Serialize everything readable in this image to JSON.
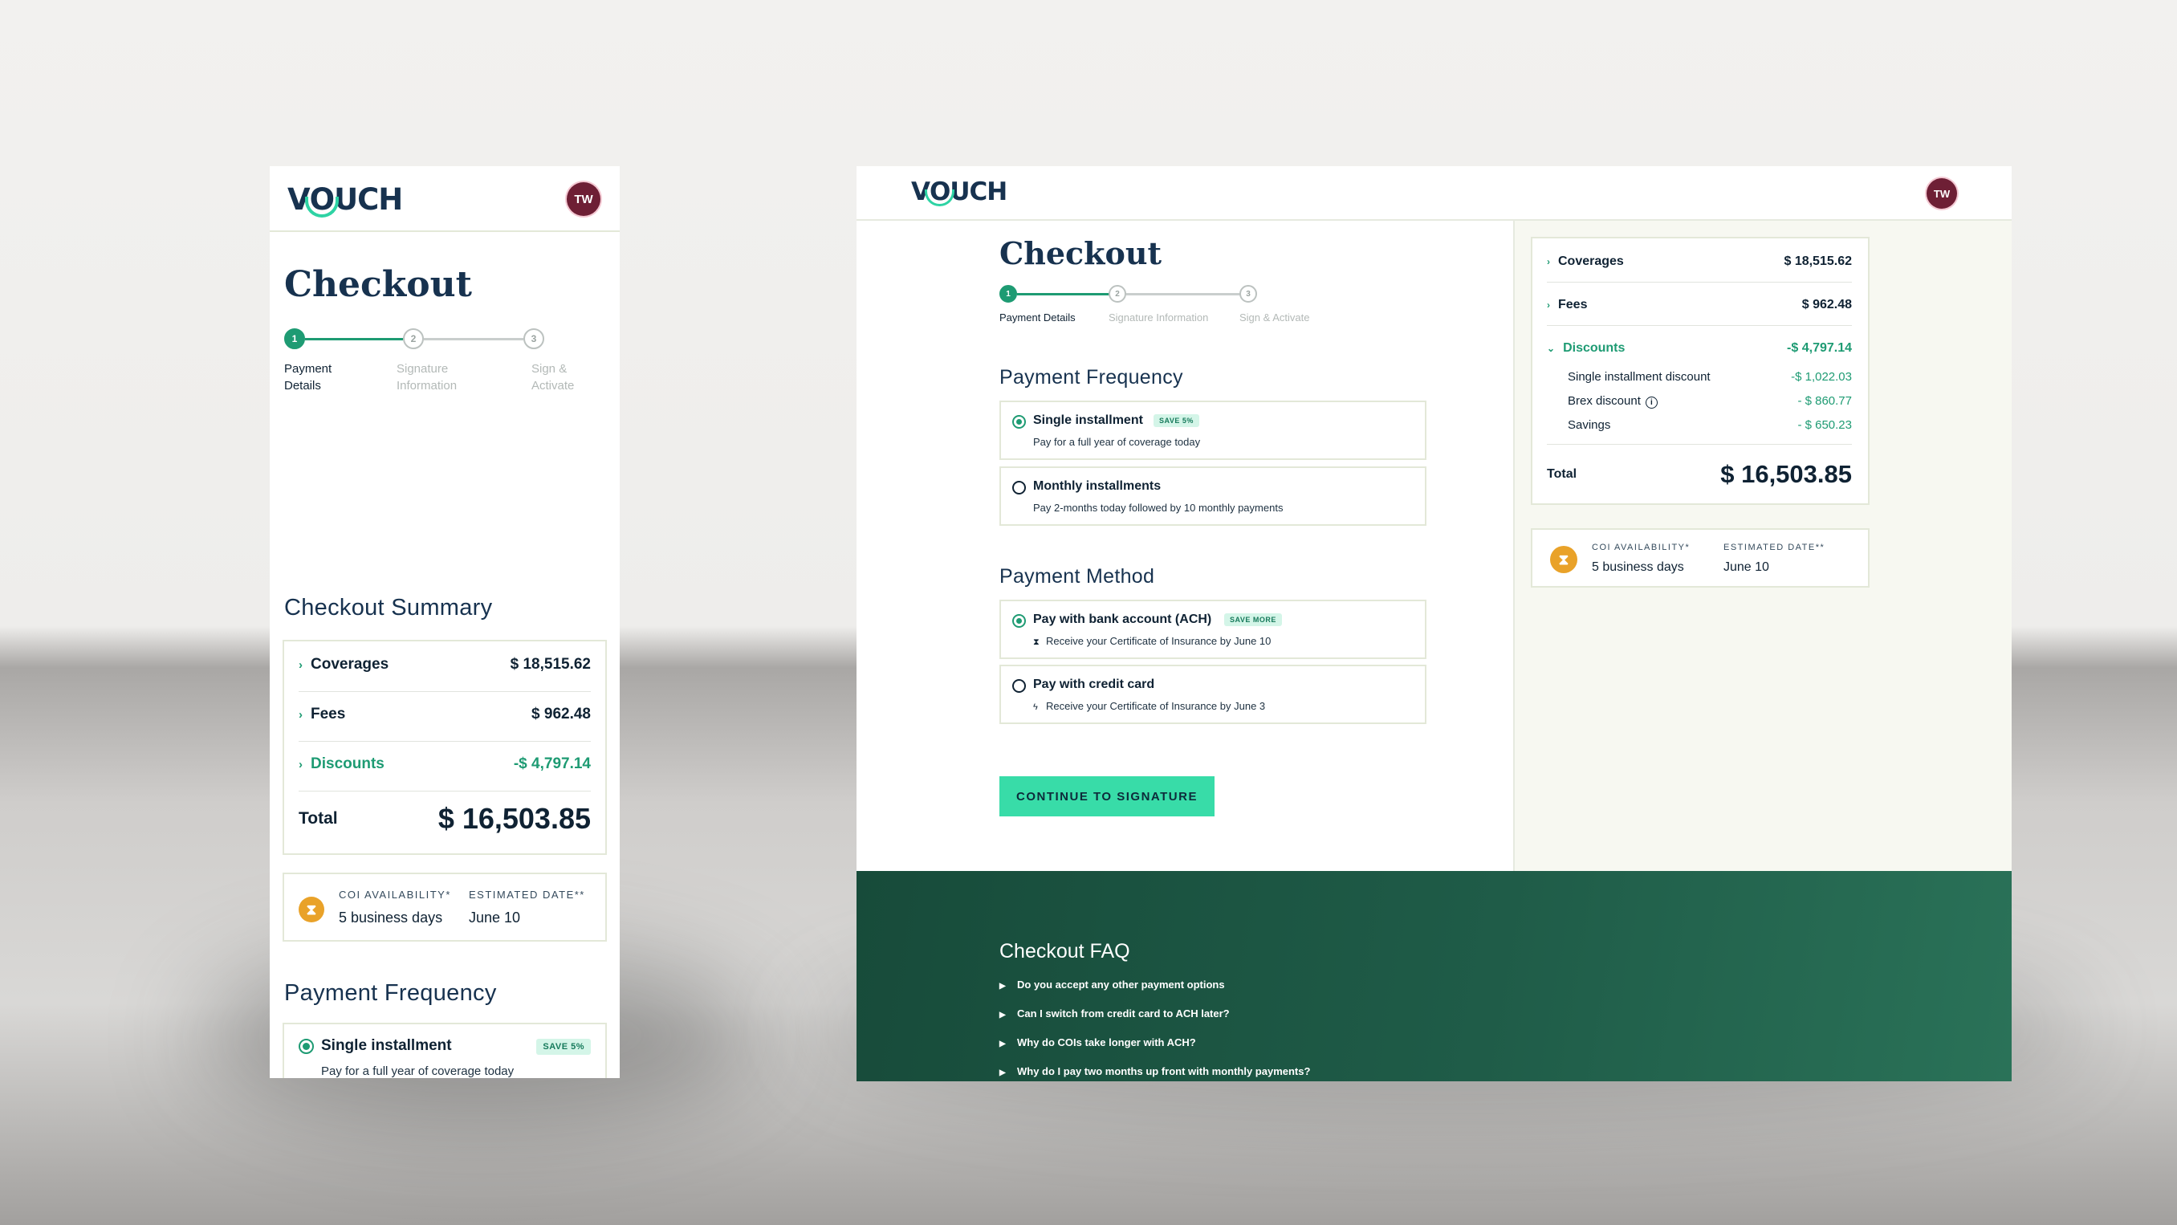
{
  "brand": {
    "logo": "VOUCH",
    "accent": "#1e9b73",
    "cta_color": "#38dca8",
    "avatar_initials": "TW",
    "avatar_color": "#6e1f35"
  },
  "checkout": {
    "title": "Checkout",
    "steps": [
      {
        "num": "1",
        "label": "Payment Details",
        "label_mobile_l1": "Payment",
        "label_mobile_l2": "Details",
        "active": true
      },
      {
        "num": "2",
        "label": "Signature Information",
        "label_mobile_l1": "Signature",
        "label_mobile_l2": "Information",
        "active": false
      },
      {
        "num": "3",
        "label": "Sign & Activate",
        "label_mobile_l1": "Sign &",
        "label_mobile_l2": "Activate",
        "active": false
      }
    ]
  },
  "summary": {
    "heading": "Checkout Summary",
    "coverages_label": "Coverages",
    "coverages_value": "$ 18,515.62",
    "fees_label": "Fees",
    "fees_value": "$ 962.48",
    "discounts_label": "Discounts",
    "discounts_value": "-$ 4,797.14",
    "discount_items": [
      {
        "label": "Single installment discount",
        "value": "-$ 1,022.03"
      },
      {
        "label": "Brex discount",
        "value": "- $ 860.77"
      },
      {
        "label": "Savings",
        "value": "- $ 650.23"
      }
    ],
    "total_label": "Total",
    "total_value": "$ 16,503.85"
  },
  "coi": {
    "availability_label": "COI AVAILABILITY*",
    "availability_value": "5 business days",
    "date_label": "ESTIMATED DATE**",
    "date_value": "June 10"
  },
  "payment_frequency": {
    "heading": "Payment Frequency",
    "options": [
      {
        "title": "Single installment",
        "badge": "SAVE 5%",
        "sub": "Pay for a full year of coverage today",
        "selected": true
      },
      {
        "title": "Monthly installments",
        "sub": "Pay 2-months today followed by 10 monthly payments",
        "selected": false
      }
    ]
  },
  "payment_method": {
    "heading": "Payment Method",
    "options": [
      {
        "title": "Pay with bank account (ACH)",
        "badge": "SAVE MORE",
        "sub": "Receive your Certificate of Insurance by June 10",
        "selected": true
      },
      {
        "title": "Pay with credit card",
        "sub": "Receive your Certificate of Insurance by June 3",
        "selected": false
      }
    ]
  },
  "cta_label": "CONTINUE TO SIGNATURE",
  "faq": {
    "heading": "Checkout FAQ",
    "items": [
      "Do you accept any other payment options",
      "Can I switch from credit card to ACH later?",
      "Why do COIs take longer with ACH?",
      "Why do I pay two months up front with monthly payments?"
    ]
  }
}
